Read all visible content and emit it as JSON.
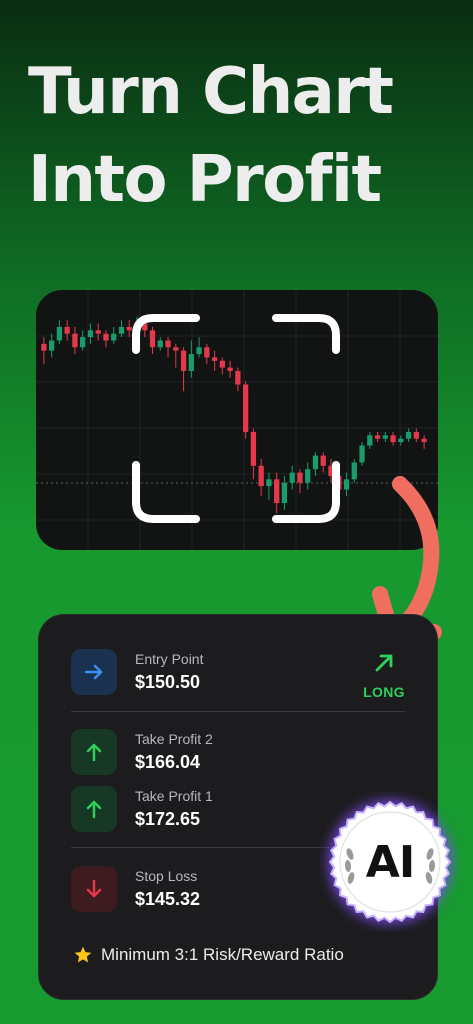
{
  "headline": {
    "line1": "Turn Chart",
    "line2": "Into Profit"
  },
  "colors": {
    "bull": "#1a9c6b",
    "bear": "#e5394b",
    "accent_green": "#2fcf5b",
    "arrow": "#f06e60",
    "badge_glow": "#7d4cf0"
  },
  "signal": {
    "direction": "LONG",
    "entry": {
      "label": "Entry Point",
      "value": "$150.50",
      "icon": "arrow-right-icon"
    },
    "take_profit_2": {
      "label": "Take Profit 2",
      "value": "$166.04",
      "icon": "arrow-up-icon"
    },
    "take_profit_1": {
      "label": "Take Profit 1",
      "value": "$172.65",
      "icon": "arrow-up-icon"
    },
    "stop_loss": {
      "label": "Stop Loss",
      "value": "$145.32",
      "icon": "arrow-down-icon"
    },
    "note": "Minimum 3:1 Risk/Reward Ratio",
    "note_icon": "star-icon"
  },
  "badge": {
    "text": "AI",
    "icon": "laurel-icon"
  },
  "candles": [
    {
      "o": 28,
      "c": 26,
      "h": 30,
      "l": 22
    },
    {
      "o": 26,
      "c": 29,
      "h": 31,
      "l": 24
    },
    {
      "o": 29,
      "c": 33,
      "h": 35,
      "l": 28
    },
    {
      "o": 33,
      "c": 31,
      "h": 35,
      "l": 29
    },
    {
      "o": 31,
      "c": 27,
      "h": 33,
      "l": 25
    },
    {
      "o": 27,
      "c": 30,
      "h": 32,
      "l": 26
    },
    {
      "o": 30,
      "c": 32,
      "h": 34,
      "l": 28
    },
    {
      "o": 32,
      "c": 31,
      "h": 34,
      "l": 29
    },
    {
      "o": 31,
      "c": 29,
      "h": 32,
      "l": 27
    },
    {
      "o": 29,
      "c": 31,
      "h": 33,
      "l": 28
    },
    {
      "o": 31,
      "c": 33,
      "h": 35,
      "l": 30
    },
    {
      "o": 33,
      "c": 32,
      "h": 35,
      "l": 30
    },
    {
      "o": 32,
      "c": 34,
      "h": 36,
      "l": 31
    },
    {
      "o": 34,
      "c": 32,
      "h": 36,
      "l": 30
    },
    {
      "o": 32,
      "c": 27,
      "h": 33,
      "l": 25
    },
    {
      "o": 27,
      "c": 29,
      "h": 30,
      "l": 26
    },
    {
      "o": 29,
      "c": 27,
      "h": 30,
      "l": 24
    },
    {
      "o": 27,
      "c": 26,
      "h": 28,
      "l": 21
    },
    {
      "o": 26,
      "c": 20,
      "h": 27,
      "l": 14
    },
    {
      "o": 20,
      "c": 25,
      "h": 29,
      "l": 18
    },
    {
      "o": 25,
      "c": 27,
      "h": 30,
      "l": 24
    },
    {
      "o": 27,
      "c": 24,
      "h": 28,
      "l": 22
    },
    {
      "o": 24,
      "c": 23,
      "h": 26,
      "l": 20
    },
    {
      "o": 23,
      "c": 21,
      "h": 24,
      "l": 19
    },
    {
      "o": 21,
      "c": 20,
      "h": 23,
      "l": 18
    },
    {
      "o": 20,
      "c": 16,
      "h": 21,
      "l": 14
    },
    {
      "o": 16,
      "c": 2,
      "h": 17,
      "l": 0
    },
    {
      "o": 2,
      "c": -8,
      "h": 3,
      "l": -12
    },
    {
      "o": -8,
      "c": -14,
      "h": -6,
      "l": -17
    },
    {
      "o": -14,
      "c": -12,
      "h": -10,
      "l": -18
    },
    {
      "o": -12,
      "c": -19,
      "h": -10,
      "l": -22
    },
    {
      "o": -19,
      "c": -13,
      "h": -11,
      "l": -21
    },
    {
      "o": -13,
      "c": -10,
      "h": -8,
      "l": -15
    },
    {
      "o": -10,
      "c": -13,
      "h": -9,
      "l": -16
    },
    {
      "o": -13,
      "c": -9,
      "h": -7,
      "l": -15
    },
    {
      "o": -9,
      "c": -5,
      "h": -4,
      "l": -11
    },
    {
      "o": -5,
      "c": -8,
      "h": -4,
      "l": -10
    },
    {
      "o": -8,
      "c": -11,
      "h": -6,
      "l": -13
    },
    {
      "o": -11,
      "c": -15,
      "h": -10,
      "l": -18
    },
    {
      "o": -15,
      "c": -12,
      "h": -10,
      "l": -17
    },
    {
      "o": -12,
      "c": -7,
      "h": -6,
      "l": -13
    },
    {
      "o": -7,
      "c": -2,
      "h": -1,
      "l": -8
    },
    {
      "o": -2,
      "c": 1,
      "h": 2,
      "l": -3
    },
    {
      "o": 1,
      "c": 0,
      "h": 2,
      "l": -1
    },
    {
      "o": 0,
      "c": 1,
      "h": 2,
      "l": -1
    },
    {
      "o": 1,
      "c": -1,
      "h": 2,
      "l": -2
    },
    {
      "o": -1,
      "c": 0,
      "h": 1,
      "l": -2
    },
    {
      "o": 0,
      "c": 2,
      "h": 3,
      "l": -1
    },
    {
      "o": 2,
      "c": 0,
      "h": 3,
      "l": -1
    },
    {
      "o": 0,
      "c": -1,
      "h": 1,
      "l": -3
    }
  ]
}
